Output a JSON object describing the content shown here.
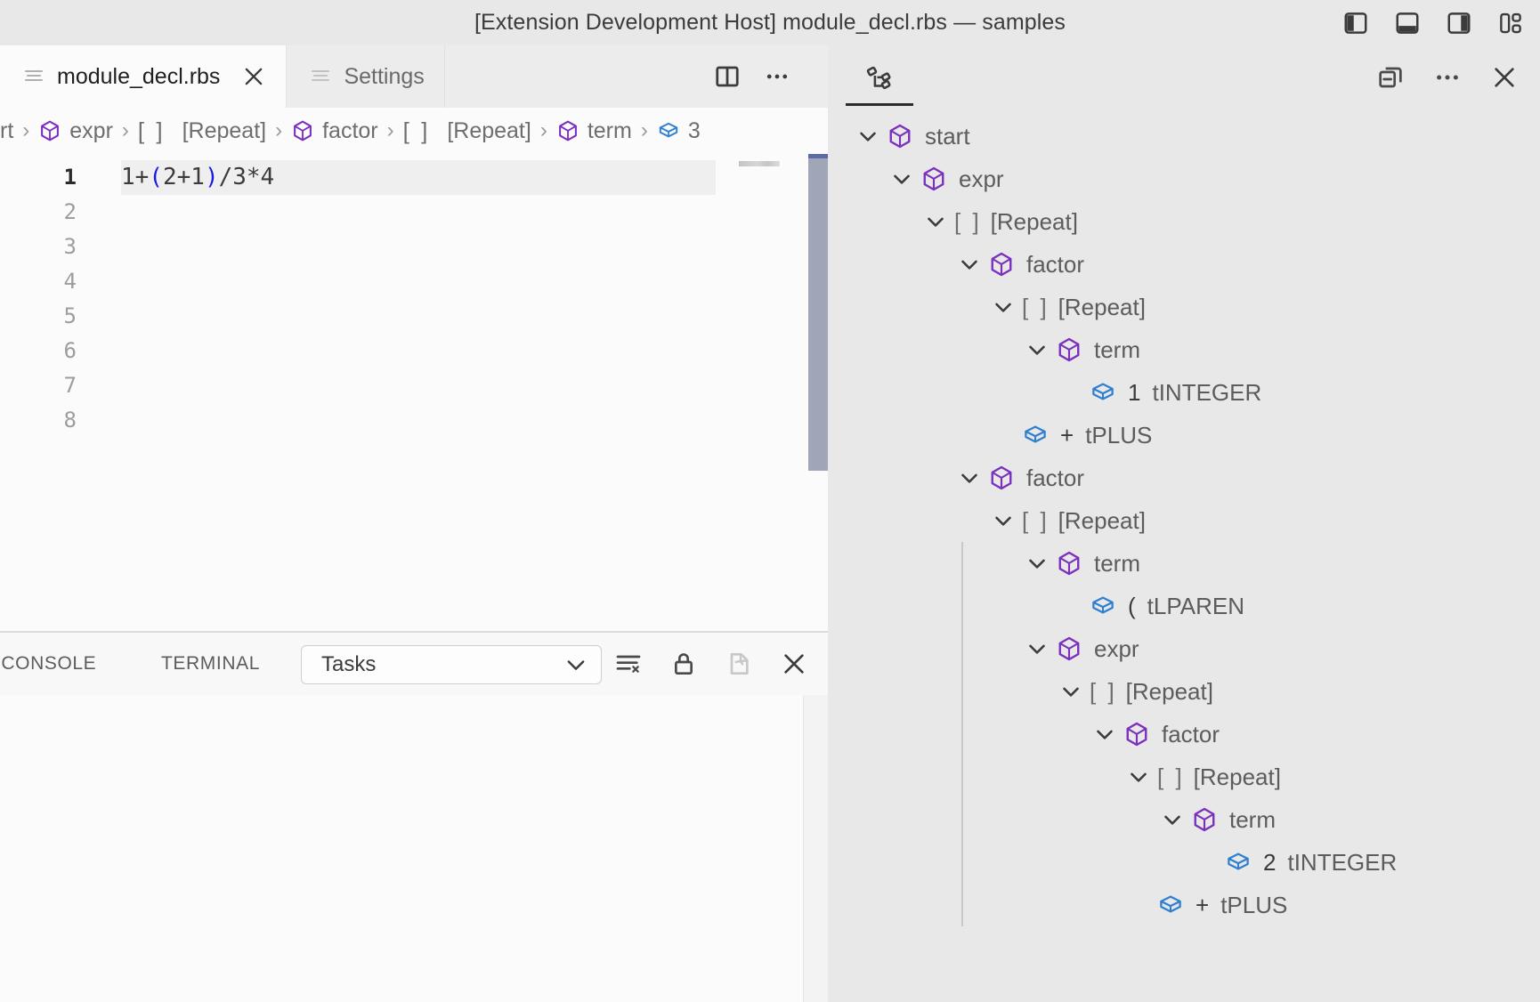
{
  "window": {
    "title": "[Extension Development Host] module_decl.rbs — samples",
    "actions": [
      {
        "name": "toggle-primary-sidebar-icon",
        "label": "Toggle Primary Side Bar"
      },
      {
        "name": "toggle-panel-icon",
        "label": "Toggle Panel"
      },
      {
        "name": "toggle-secondary-sidebar-icon",
        "label": "Toggle Secondary Side Bar"
      },
      {
        "name": "customize-layout-icon",
        "label": "Customize Layout"
      }
    ]
  },
  "tabs": [
    {
      "label": "module_decl.rbs",
      "icon": "file-lines-icon",
      "active": true,
      "closable": true
    },
    {
      "label": "Settings",
      "icon": "file-lines-icon",
      "active": false,
      "closable": false
    }
  ],
  "editor_actions": [
    {
      "name": "split-editor-icon",
      "label": "Split Editor"
    },
    {
      "name": "more-actions-icon",
      "label": "More Actions..."
    }
  ],
  "breadcrumbs": {
    "separator": "›",
    "items": [
      {
        "label": "rt",
        "icon": "none",
        "truncated": true
      },
      {
        "label": "expr",
        "icon": "rule-cube-icon"
      },
      {
        "label": "[Repeat]",
        "icon": "repeat-brackets-icon"
      },
      {
        "label": "factor",
        "icon": "rule-cube-icon"
      },
      {
        "label": "[Repeat]",
        "icon": "repeat-brackets-icon"
      },
      {
        "label": "term",
        "icon": "rule-cube-icon"
      },
      {
        "label": "3",
        "icon": "token-box-icon"
      }
    ]
  },
  "code": {
    "line_numbers": [
      "1",
      "2",
      "3",
      "4",
      "5",
      "6",
      "7",
      "8"
    ],
    "active_line": 1,
    "lines": [
      {
        "pre": "1+",
        "paren_open": "(",
        "mid": "2+1",
        "paren_close": ")",
        "post": "/3*4"
      }
    ],
    "full_text": "1+(2+1)/3*4"
  },
  "panel": {
    "tabs": [
      {
        "label": "G CONSOLE",
        "name": "panel-tab-debug-console",
        "active": false
      },
      {
        "label": "TERMINAL",
        "name": "panel-tab-terminal",
        "active": false
      }
    ],
    "select": {
      "value": "Tasks",
      "options": [
        "Tasks"
      ]
    },
    "actions": [
      {
        "name": "clear-terminal-icon",
        "label": "Clear Terminal"
      },
      {
        "name": "lock-icon",
        "label": "Lock"
      },
      {
        "name": "new-terminal-icon",
        "label": "New Terminal"
      },
      {
        "name": "close-panel-icon",
        "label": "Close Panel"
      }
    ]
  },
  "aux_bar": {
    "view_icon": {
      "name": "syntax-tree-icon",
      "label": "Syntax Tree"
    },
    "actions": [
      {
        "name": "collapse-all-icon",
        "label": "Collapse All"
      },
      {
        "name": "more-actions-icon",
        "label": "Views and More Actions..."
      },
      {
        "name": "close-icon",
        "label": "Close"
      }
    ]
  },
  "tree": {
    "rows": [
      {
        "depth": 0,
        "twist": "down",
        "icon": "rule-cube-icon",
        "label": "start"
      },
      {
        "depth": 1,
        "twist": "down",
        "icon": "rule-cube-icon",
        "label": "expr"
      },
      {
        "depth": 2,
        "twist": "down",
        "icon": "repeat-brackets-icon",
        "label": "[Repeat]"
      },
      {
        "depth": 3,
        "twist": "down",
        "icon": "rule-cube-icon",
        "label": "factor"
      },
      {
        "depth": 4,
        "twist": "down",
        "icon": "repeat-brackets-icon",
        "label": "[Repeat]"
      },
      {
        "depth": 5,
        "twist": "down",
        "icon": "rule-cube-icon",
        "label": "term"
      },
      {
        "depth": 6,
        "twist": "none",
        "icon": "token-box-icon",
        "value": "1",
        "label": "tINTEGER"
      },
      {
        "depth": 4,
        "twist": "none",
        "icon": "token-box-icon",
        "value": "+",
        "label": "tPLUS"
      },
      {
        "depth": 3,
        "twist": "down",
        "icon": "rule-cube-icon",
        "label": "factor"
      },
      {
        "depth": 4,
        "twist": "down",
        "icon": "repeat-brackets-icon",
        "label": "[Repeat]"
      },
      {
        "depth": 5,
        "twist": "down",
        "icon": "rule-cube-icon",
        "label": "term",
        "guide": true
      },
      {
        "depth": 6,
        "twist": "none",
        "icon": "token-box-icon",
        "value": "(",
        "label": "tLPAREN",
        "guide": true
      },
      {
        "depth": 5,
        "twist": "down",
        "icon": "rule-cube-icon",
        "label": "expr",
        "guide": true
      },
      {
        "depth": 6,
        "twist": "down",
        "icon": "repeat-brackets-icon",
        "label": "[Repeat]",
        "guide": true
      },
      {
        "depth": 7,
        "twist": "down",
        "icon": "rule-cube-icon",
        "label": "factor",
        "guide": true
      },
      {
        "depth": 8,
        "twist": "down",
        "icon": "repeat-brackets-icon",
        "label": "[Repeat]",
        "guide": true
      },
      {
        "depth": 9,
        "twist": "down",
        "icon": "rule-cube-icon",
        "label": "term",
        "guide": true
      },
      {
        "depth": 10,
        "twist": "none",
        "icon": "token-box-icon",
        "value": "2",
        "label": "tINTEGER",
        "guide": true
      },
      {
        "depth": 8,
        "twist": "none",
        "icon": "token-box-icon",
        "value": "+",
        "label": "tPLUS",
        "guide": true
      }
    ]
  },
  "colors": {
    "rule_icon": "#7b2fbe",
    "token_icon": "#2f7fd1",
    "paren_token": "#1a1ae6",
    "title_bar_bg": "#e8e8e8",
    "editor_bg": "#fbfbfb",
    "scrollbar_thumb": "#a0a5b8"
  }
}
